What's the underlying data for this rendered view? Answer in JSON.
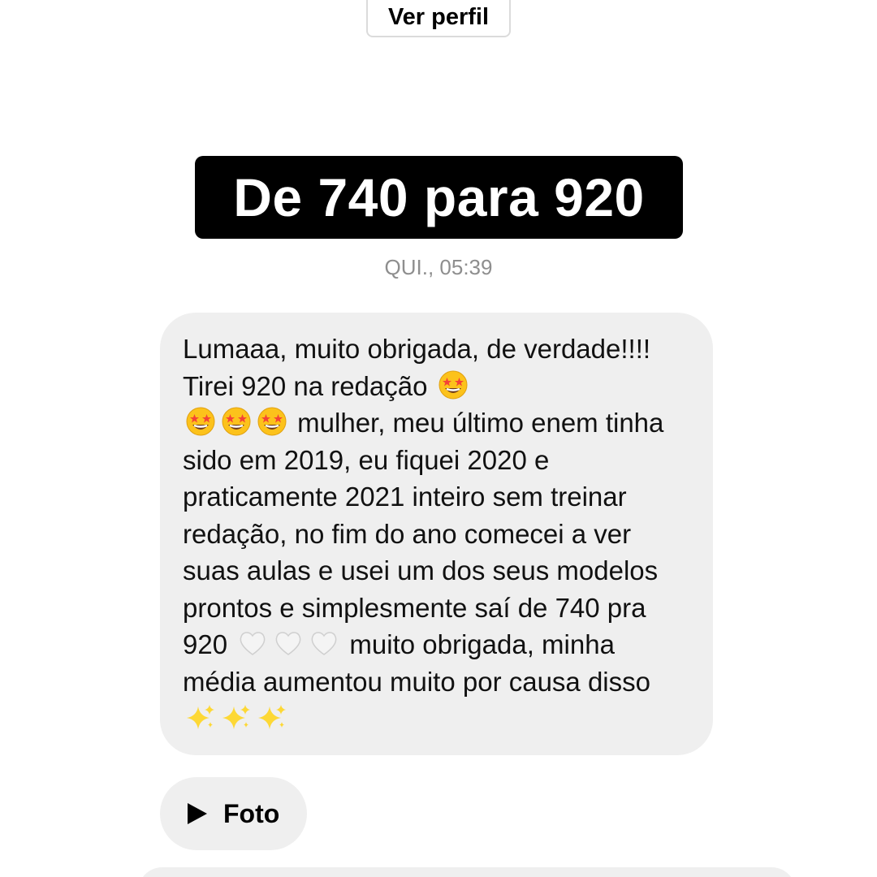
{
  "profile": {
    "button_label": "Ver perfil"
  },
  "banner": {
    "text": "De 740 para 920"
  },
  "timestamp": "QUI., 05:39",
  "message": {
    "part1": "Lumaaa, muito obrigada, de verdade!!!! Tirei 920 na redação",
    "part2": "mulher, meu último enem tinha sido em 2019, eu fiquei 2020 e praticamente 2021 inteiro sem treinar redação, no fim do ano comecei a ver suas aulas e usei um dos seus modelos prontos e simplesmente saí de 740 pra 920",
    "part3": "muito obrigada, minha média aumentou muito por causa disso",
    "emoji": {
      "star_struck": "star-struck-emoji-icon",
      "white_heart": "white-heart-emoji-icon",
      "sparkles": "sparkles-emoji-icon"
    }
  },
  "attachment": {
    "label": "Foto",
    "icon": "play-icon"
  },
  "colors": {
    "bubble_bg": "#efefef",
    "banner_bg": "#000000",
    "timestamp": "#8e8e8e"
  }
}
